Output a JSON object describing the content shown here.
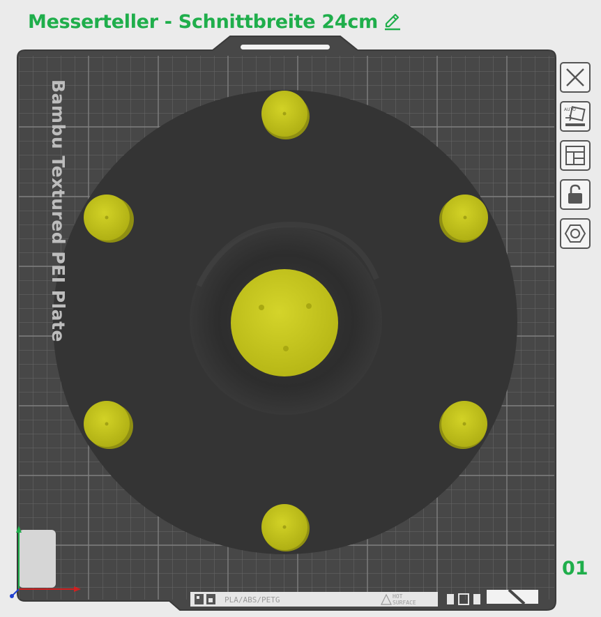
{
  "header": {
    "project_title": "Messerteller - Schnittbreite 24cm",
    "edit_icon": "pencil-icon"
  },
  "plate": {
    "label": "Bambu Textured PEI Plate",
    "number": "01",
    "material_tag": "PLA/ABS/PETG",
    "warning_tag_line1": "HOT",
    "warning_tag_line2": "SURFACE"
  },
  "toolbar": {
    "items": [
      {
        "name": "close-plate-button",
        "icon": "close-icon"
      },
      {
        "name": "auto-orient-button",
        "icon": "auto-orient-icon"
      },
      {
        "name": "arrange-button",
        "icon": "arrange-layout-icon"
      },
      {
        "name": "lock-button",
        "icon": "unlock-icon"
      },
      {
        "name": "plate-settings-button",
        "icon": "hexagon-nut-icon"
      }
    ]
  },
  "colors": {
    "title_green": "#1fae4b",
    "plate_gray": "#4a4a4a",
    "grid_line": "#6e6e6e",
    "model_dark": "#333333",
    "part_yellow": "#c8c81e"
  }
}
